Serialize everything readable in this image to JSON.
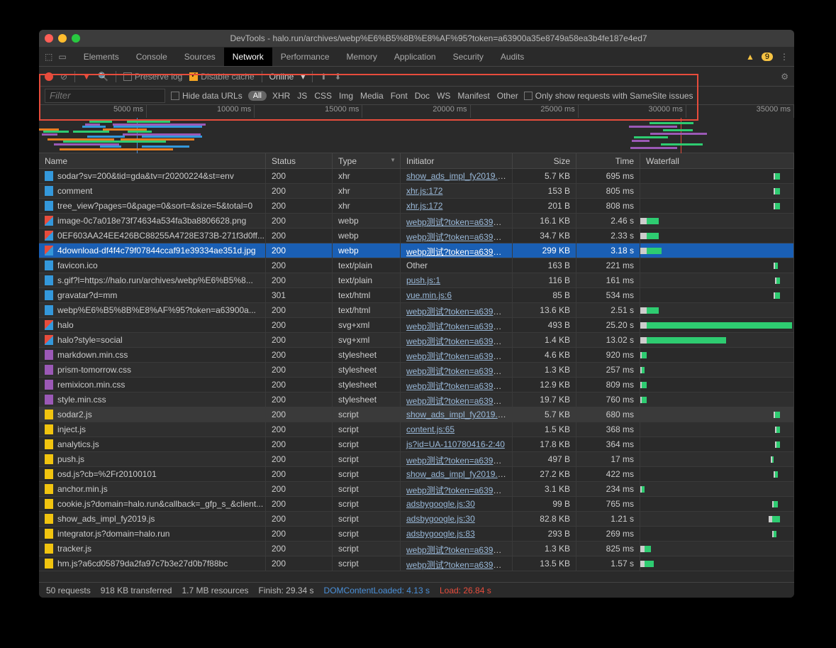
{
  "title": "DevTools - halo.run/archives/webp%E6%B5%8B%E8%AF%95?token=a63900a35e8749a58ea3b4fe187e4ed7",
  "tabs": [
    "Elements",
    "Console",
    "Sources",
    "Network",
    "Performance",
    "Memory",
    "Application",
    "Security",
    "Audits"
  ],
  "active_tab": "Network",
  "warnings": "9",
  "toolbar": {
    "preserve": "Preserve log",
    "disable": "Disable cache",
    "throttle": "Online"
  },
  "filter": {
    "placeholder": "Filter",
    "hide_urls": "Hide data URLs",
    "all": "All",
    "types": [
      "XHR",
      "JS",
      "CSS",
      "Img",
      "Media",
      "Font",
      "Doc",
      "WS",
      "Manifest",
      "Other"
    ],
    "samesite": "Only show requests with SameSite issues"
  },
  "ruler": [
    "5000 ms",
    "10000 ms",
    "15000 ms",
    "20000 ms",
    "25000 ms",
    "30000 ms",
    "35000 ms"
  ],
  "columns": {
    "name": "Name",
    "status": "Status",
    "type": "Type",
    "init": "Initiator",
    "size": "Size",
    "time": "Time",
    "wf": "Waterfall"
  },
  "rows": [
    {
      "name": "sodar?sv=200&tid=gda&tv=r20200224&st=env",
      "status": "200",
      "type": "xhr",
      "init": "show_ads_impl_fy2019.js...",
      "size": "5.7 KB",
      "time": "695 ms",
      "ic": "doc",
      "wf": [
        87,
        1,
        3,
        "g"
      ]
    },
    {
      "name": "comment",
      "status": "200",
      "type": "xhr",
      "init": "xhr.js:172",
      "size": "153 B",
      "time": "805 ms",
      "ic": "doc",
      "wf": [
        87,
        1,
        3,
        "g"
      ]
    },
    {
      "name": "tree_view?pages=0&page=0&sort=&size=5&total=0",
      "status": "200",
      "type": "xhr",
      "init": "xhr.js:172",
      "size": "201 B",
      "time": "808 ms",
      "ic": "doc",
      "wf": [
        87,
        1,
        3,
        "g"
      ]
    },
    {
      "name": "image-0c7a018e73f74634a534fa3ba8806628.png",
      "status": "200",
      "type": "webp",
      "init": "webp测试?token=a63900...",
      "size": "16.1 KB",
      "time": "2.46 s",
      "ic": "img",
      "wf": [
        0,
        4,
        8,
        "g"
      ],
      "box": true
    },
    {
      "name": "0EF603AA24EE426BC88255A4728E373B-271f3d0ff...",
      "status": "200",
      "type": "webp",
      "init": "webp测试?token=a63900...",
      "size": "34.7 KB",
      "time": "2.33 s",
      "ic": "img",
      "wf": [
        0,
        4,
        8,
        "g"
      ]
    },
    {
      "name": "4download-df4f4c79f07844ccaf91e39334ae351d.jpg",
      "status": "200",
      "type": "webp",
      "init": "webp测试?token=a63900...",
      "size": "299 KB",
      "time": "3.18 s",
      "ic": "img",
      "wf": [
        0,
        4,
        10,
        "g"
      ],
      "sel": true
    },
    {
      "name": "favicon.ico",
      "status": "200",
      "type": "text/plain",
      "init": "Other",
      "size": "163 B",
      "time": "221 ms",
      "ic": "doc",
      "wf": [
        87,
        1,
        2,
        "g"
      ],
      "nolink": true
    },
    {
      "name": "s.gif?l=https://halo.run/archives/webp%E6%B5%8...",
      "status": "200",
      "type": "text/plain",
      "init": "push.js:1",
      "size": "116 B",
      "time": "161 ms",
      "ic": "doc",
      "wf": [
        88,
        1,
        2,
        "g"
      ]
    },
    {
      "name": "gravatar?d=mm",
      "status": "301",
      "type": "text/html",
      "init": "vue.min.js:6",
      "size": "85 B",
      "time": "534 ms",
      "ic": "doc",
      "wf": [
        87,
        1,
        3,
        "g"
      ]
    },
    {
      "name": "webp%E6%B5%8B%E8%AF%95?token=a63900a...",
      "status": "200",
      "type": "text/html",
      "init": "webp测试?token=a63900...",
      "size": "13.6 KB",
      "time": "2.51 s",
      "ic": "doc",
      "wf": [
        0,
        4,
        8,
        "g"
      ]
    },
    {
      "name": "halo",
      "status": "200",
      "type": "svg+xml",
      "init": "webp测试?token=a63900...",
      "size": "493 B",
      "time": "25.20 s",
      "ic": "img",
      "wf": [
        0,
        4,
        95,
        "g"
      ]
    },
    {
      "name": "halo?style=social",
      "status": "200",
      "type": "svg+xml",
      "init": "webp测试?token=a63900...",
      "size": "1.4 KB",
      "time": "13.02 s",
      "ic": "img",
      "wf": [
        0,
        4,
        52,
        "g"
      ]
    },
    {
      "name": "markdown.min.css",
      "status": "200",
      "type": "stylesheet",
      "init": "webp测试?token=a63900...",
      "size": "4.6 KB",
      "time": "920 ms",
      "ic": "css",
      "wf": [
        0,
        1,
        3,
        "g"
      ]
    },
    {
      "name": "prism-tomorrow.css",
      "status": "200",
      "type": "stylesheet",
      "init": "webp测试?token=a63900...",
      "size": "1.3 KB",
      "time": "257 ms",
      "ic": "css",
      "wf": [
        0,
        1,
        2,
        "g"
      ]
    },
    {
      "name": "remixicon.min.css",
      "status": "200",
      "type": "stylesheet",
      "init": "webp测试?token=a63900...",
      "size": "12.9 KB",
      "time": "809 ms",
      "ic": "css",
      "wf": [
        0,
        1,
        3,
        "g"
      ]
    },
    {
      "name": "style.min.css",
      "status": "200",
      "type": "stylesheet",
      "init": "webp测试?token=a63900...",
      "size": "19.7 KB",
      "time": "760 ms",
      "ic": "css",
      "wf": [
        0,
        1,
        3,
        "g"
      ]
    },
    {
      "name": "sodar2.js",
      "status": "200",
      "type": "script",
      "init": "show_ads_impl_fy2019.js...",
      "size": "5.7 KB",
      "time": "680 ms",
      "ic": "js",
      "wf": [
        87,
        1,
        3,
        "g"
      ],
      "hl": true
    },
    {
      "name": "inject.js",
      "status": "200",
      "type": "script",
      "init": "content.js:65",
      "size": "1.5 KB",
      "time": "368 ms",
      "ic": "js",
      "wf": [
        88,
        1,
        2,
        "g"
      ]
    },
    {
      "name": "analytics.js",
      "status": "200",
      "type": "script",
      "init": "js?id=UA-110780416-2:40",
      "size": "17.8 KB",
      "time": "364 ms",
      "ic": "js",
      "wf": [
        88,
        1,
        2,
        "g"
      ]
    },
    {
      "name": "push.js",
      "status": "200",
      "type": "script",
      "init": "webp测试?token=a63900...",
      "size": "497 B",
      "time": "17 ms",
      "ic": "js",
      "wf": [
        85,
        1,
        1,
        "g"
      ]
    },
    {
      "name": "osd.js?cb=%2Fr20100101",
      "status": "200",
      "type": "script",
      "init": "show_ads_impl_fy2019.js...",
      "size": "27.2 KB",
      "time": "422 ms",
      "ic": "js",
      "wf": [
        87,
        1,
        2,
        "g"
      ]
    },
    {
      "name": "anchor.min.js",
      "status": "200",
      "type": "script",
      "init": "webp测试?token=a63900...",
      "size": "3.1 KB",
      "time": "234 ms",
      "ic": "js",
      "wf": [
        0,
        1,
        2,
        "g"
      ]
    },
    {
      "name": "cookie.js?domain=halo.run&callback=_gfp_s_&client...",
      "status": "200",
      "type": "script",
      "init": "adsbygoogle.js:30",
      "size": "99 B",
      "time": "765 ms",
      "ic": "js",
      "wf": [
        86,
        1,
        3,
        "g"
      ]
    },
    {
      "name": "show_ads_impl_fy2019.js",
      "status": "200",
      "type": "script",
      "init": "adsbygoogle.js:30",
      "size": "82.8 KB",
      "time": "1.21 s",
      "ic": "js",
      "wf": [
        84,
        2,
        5,
        "g"
      ]
    },
    {
      "name": "integrator.js?domain=halo.run",
      "status": "200",
      "type": "script",
      "init": "adsbygoogle.js:83",
      "size": "293 B",
      "time": "269 ms",
      "ic": "js",
      "wf": [
        86,
        1,
        2,
        "g"
      ]
    },
    {
      "name": "tracker.js",
      "status": "200",
      "type": "script",
      "init": "webp测试?token=a63900...",
      "size": "1.3 KB",
      "time": "825 ms",
      "ic": "js",
      "wf": [
        0,
        3,
        4,
        "g"
      ]
    },
    {
      "name": "hm.js?a6cd05879da2fa97c7b3e27d0b7f88bc",
      "status": "200",
      "type": "script",
      "init": "webp测试?token=a63900...",
      "size": "13.5 KB",
      "time": "1.57 s",
      "ic": "js",
      "wf": [
        0,
        3,
        6,
        "g"
      ]
    }
  ],
  "status": {
    "req": "50 requests",
    "xfer": "918 KB transferred",
    "res": "1.7 MB resources",
    "fin": "Finish: 29.34 s",
    "dcl": "DOMContentLoaded: 4.13 s",
    "load": "Load: 26.84 s"
  }
}
